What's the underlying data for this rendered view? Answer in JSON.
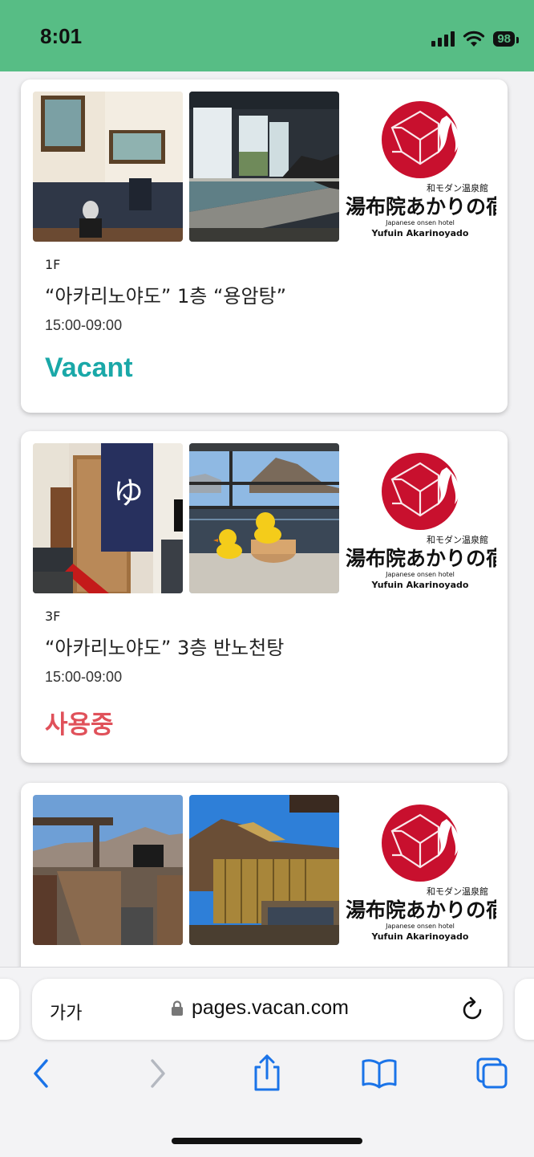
{
  "statusbar": {
    "time": "8:01",
    "battery": "98"
  },
  "colors": {
    "statusbar_bg": "#57bd85",
    "vacant": "#1aa8a8",
    "occupied": "#e0515a",
    "accent_blue": "#1a73e8",
    "logo_red": "#c8102e"
  },
  "logo": {
    "tagline": "和モダン温泉館",
    "name_jp": "湯布院あかりの宿",
    "subtitle": "Japanese onsen hotel",
    "name_en": "Yufuin Akarinoyado"
  },
  "cards": [
    {
      "floor": "1F",
      "name": "“아카리노야도” 1층 “용암탕”",
      "hours": "15:00-09:00",
      "status": "Vacant"
    },
    {
      "floor": "3F",
      "name": "“아카리노야도” 3층 반노천탕",
      "hours": "15:00-09:00",
      "status": "사용중"
    },
    {
      "floor": "",
      "name": "",
      "hours": "",
      "status": ""
    }
  ],
  "browser": {
    "text_size_label": "가가",
    "url": "pages.vacan.com"
  },
  "icons": {
    "lock": "lock-icon",
    "reload": "reload-icon",
    "back": "back-icon",
    "forward": "forward-icon",
    "share": "share-icon",
    "bookmarks": "bookmarks-icon",
    "tabs": "tabs-icon",
    "signal": "signal-icon",
    "wifi": "wifi-icon",
    "battery": "battery-icon"
  }
}
